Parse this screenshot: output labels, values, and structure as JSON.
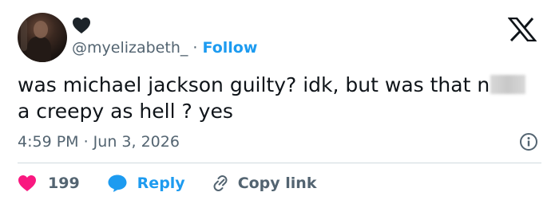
{
  "user": {
    "handle": "@myelizabeth_",
    "separator": "·",
    "follow_label": "Follow",
    "avatar_icon": "profile-photo",
    "badge_icon": "heart-icon"
  },
  "tweet": {
    "text_before": "was michael jackson guilty? idk, but was that n",
    "text_after": "a creepy as hell ? yes",
    "timestamp": "4:59 PM · Jun 3, 2026"
  },
  "actions": {
    "like_count": "199",
    "reply_label": "Reply",
    "copy_label": "Copy link"
  },
  "colors": {
    "accent": "#1d9bf0",
    "like": "#f91880",
    "secondary_text": "#536471",
    "divider": "#cfd9de"
  }
}
